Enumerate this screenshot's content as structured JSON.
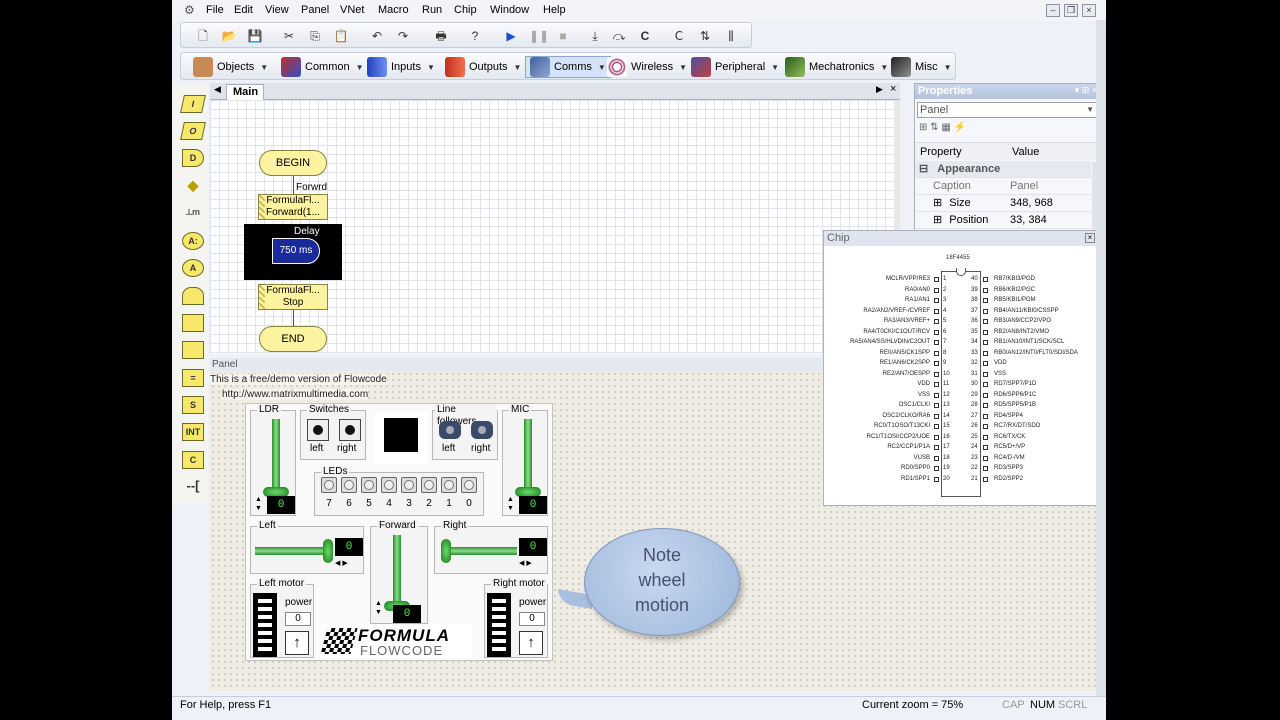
{
  "menu": [
    "File",
    "Edit",
    "View",
    "Panel",
    "VNet",
    "Macro",
    "Run",
    "Chip",
    "Window",
    "Help"
  ],
  "toolbar_categories": [
    {
      "label": "Objects",
      "color": "#7a4a2a"
    },
    {
      "label": "Common",
      "color": "#3a5db0"
    },
    {
      "label": "Inputs",
      "color": "#2040c0"
    },
    {
      "label": "Outputs",
      "color": "#c03020"
    },
    {
      "label": "Comms",
      "color": "#4060a0"
    },
    {
      "label": "Wireless",
      "color": "#a03070"
    },
    {
      "label": "Peripheral",
      "color": "#5050a0"
    },
    {
      "label": "Mechatronics",
      "color": "#3a7a2a"
    },
    {
      "label": "Misc",
      "color": "#404040"
    }
  ],
  "main_tab": "Main",
  "flowchart": {
    "begin": "BEGIN",
    "forward_label": "Forwrd",
    "calc1_line1": "FormulaFl...",
    "calc1_line2": "Forward(1...",
    "delay_label": "Delay",
    "delay_value": "750 ms",
    "calc2_line1": "FormulaFl...",
    "calc2_line2": "Stop",
    "end": "END"
  },
  "properties": {
    "title": "Properties",
    "selected": "Panel",
    "col_property": "Property",
    "col_value": "Value",
    "section": "Appearance",
    "rows": [
      {
        "name": "Caption",
        "value": "Panel"
      },
      {
        "name": "Size",
        "value": "348, 968"
      },
      {
        "name": "Position",
        "value": "33, 384"
      }
    ]
  },
  "panel": {
    "header": "Panel",
    "demo_line1": "This is a free/demo version of Flowcode",
    "demo_line2": "http://www.matrixmultimedia.com"
  },
  "sim": {
    "ldr": "LDR",
    "switches": "Switches",
    "sw_left": "left",
    "sw_right": "right",
    "line_followers": "Line followers",
    "lf_left": "left",
    "lf_right": "right",
    "mic": "MIC",
    "leds": "LEDs",
    "led_numbers": [
      "7",
      "6",
      "5",
      "4",
      "3",
      "2",
      "1",
      "0"
    ],
    "ldr_value": "0",
    "mic_value": "0",
    "left": "Left",
    "left_value": "0",
    "forward": "Forward",
    "forward_value": "0",
    "right": "Right",
    "right_value": "0",
    "left_motor": "Left motor",
    "right_motor": "Right motor",
    "power": "power",
    "lm_power": "0",
    "rm_power": "0",
    "logo_line1": "FORMULA",
    "logo_line2": "FLOWCODE"
  },
  "chip": {
    "title": "Chip",
    "part": "18F4455",
    "left_pins": [
      "MCLR/VPP/RE3",
      "RA0/AN0",
      "RA1/AN1",
      "RA2/AN2/VREF-/CVREF",
      "RA3/AN3/VREF+",
      "RA4/T0CKI/C1OUT/RCV",
      "RA5/AN4/SS/HLVDIN/C2OUT",
      "RE0/AN5/CK1SPP",
      "RE1/AN6/CK2SPP",
      "RE2/AN7/OESPP",
      "VDD",
      "VSS",
      "OSC1/CLKI",
      "OSC2/CLKO/RA6",
      "RC0/T1OSO/T13CKI",
      "RC1/T1OSI/CCP2/UOE",
      "RC2/CCP1/P1A",
      "VUSB",
      "RD0/SPP0",
      "RD1/SPP1"
    ],
    "right_pins": [
      "RB7/KBI3/PGD",
      "RB6/KBI2/PGC",
      "RB5/KBI1/PGM",
      "RB4/AN11/KBI0/CSSPP",
      "RB3/AN9/CCP2/VPO",
      "RB2/AN8/INT2/VMO",
      "RB1/AN10/INT1/SCK/SCL",
      "RB0/AN12/INT0/FLT0/SDI/SDA",
      "VDD",
      "VSS",
      "RD7/SPP7/P1D",
      "RD6/SPP6/P1C",
      "RD5/SPP5/P1B",
      "RD4/SPP4",
      "RC7/RX/DT/SDO",
      "RC6/TX/CK",
      "RC5/D+/VP",
      "RC4/D-/VM",
      "RD3/SPP3",
      "RD2/SPP2"
    ]
  },
  "bubble": {
    "line1": "Note",
    "line2": "wheel",
    "line3": "motion"
  },
  "status": {
    "help": "For Help, press F1",
    "zoom": "Current zoom = 75%",
    "cap": "CAP",
    "num": "NUM",
    "scrl": "SCRL"
  }
}
